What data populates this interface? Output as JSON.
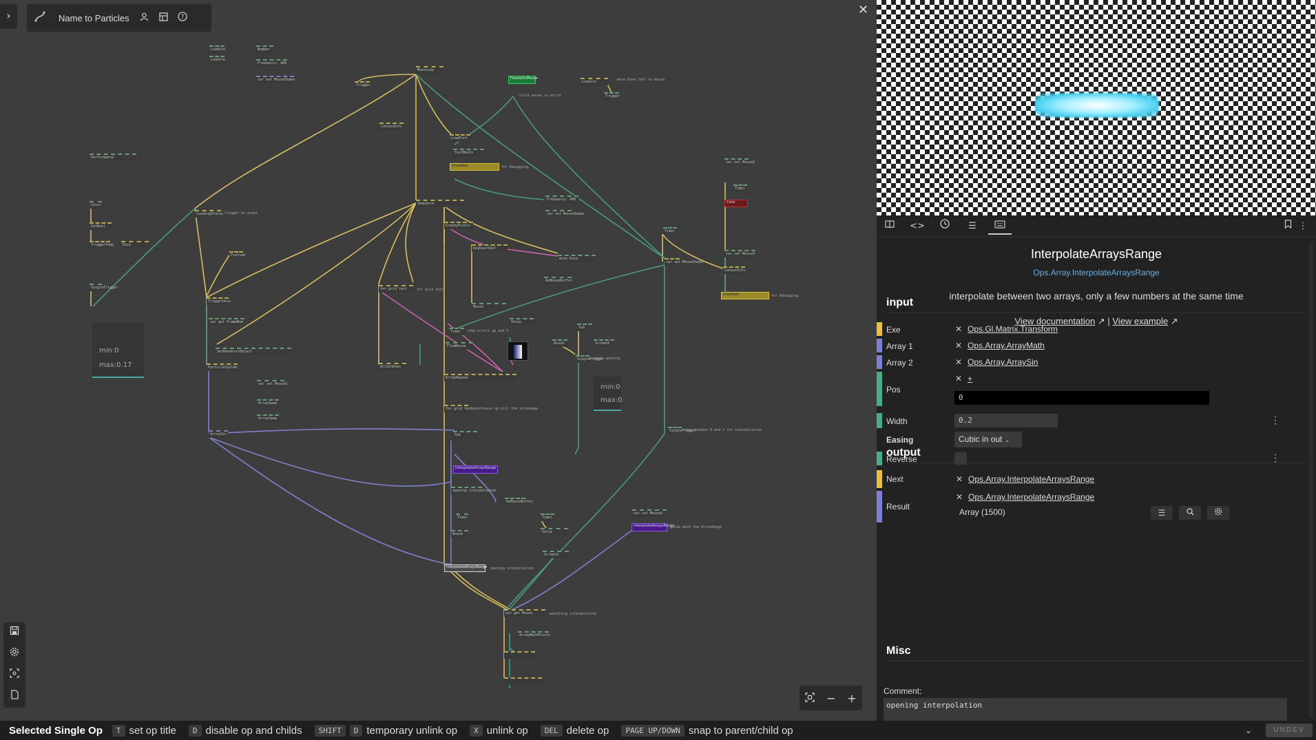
{
  "project": {
    "name": "Name to Particles"
  },
  "statusbar": {
    "selection": "Selected Single Op",
    "hints": [
      {
        "keys": [
          "T"
        ],
        "text": "set op title"
      },
      {
        "keys": [
          "D"
        ],
        "text": "disable op and childs"
      },
      {
        "keys": [
          "SHIFT",
          "D"
        ],
        "text": "temporary unlink op"
      },
      {
        "keys": [
          "X"
        ],
        "text": "unlink op"
      },
      {
        "keys": [
          "DEL"
        ],
        "text": "delete op"
      },
      {
        "keys": [
          "PAGE UP/DOWN"
        ],
        "text": "snap to parent/child op"
      }
    ]
  },
  "canvas": {
    "minmax1": {
      "min": "min:0",
      "max": "max:0.17"
    },
    "minmax2": {
      "min": "min:0",
      "max": "max:0"
    },
    "ops": [
      "Loadite",
      "Loadite",
      "Number",
      "Frequency: 480",
      "var set MouseShake",
      "MainLoop",
      "Trigger",
      "CanvasInfo",
      "FreezeOnMouse",
      "LoadFont",
      "TextMeshs",
      "DrawText",
      "for Debugging",
      "Sequence",
      "Performance",
      "Color",
      "SetBool",
      "TriggerPump",
      "Ease",
      "SingleTrigger",
      "LoadingStatus",
      "trigger on event",
      "Preload",
      "TriggerOnce",
      "var get FrameNum",
      "SetRendererObject",
      "ParticleSystem",
      "for grid test",
      "GreedyPixels",
      "KeyboardSet",
      "Mouse",
      "move Ease",
      "ActionDown",
      "Timer",
      "Value",
      "FlowMouse",
      "ArrayRepeat",
      "Sub",
      "Round",
      "ScreenX",
      "AsMouseBuffer",
      "for Debugging",
      "ArrayAddShed",
      "ArraySin",
      "var set MouseX",
      "ArraySwap",
      "InterpolateArraysRange",
      "opening interpolation",
      "InterpolateArraysRange",
      "smoothing interpolation",
      "var get Mouse",
      "TransformArray3",
      "ArrayMathPoints"
    ],
    "comments": [
      "trigger on event",
      "move Ease left to mouse",
      "click mouse in world",
      "for Debugging",
      "for debugging",
      "for grid test",
      "step scroll up and X",
      "animate opening",
      "smoothness up kill the Screengap",
      "step between 0 and 1 for interpolation",
      "guide mesh the ArrayRange",
      "opening interpolation",
      "smoothing interpolation"
    ]
  },
  "panel": {
    "tabs": [
      "book-icon",
      "code-icon",
      "clock-icon",
      "list-icon",
      "keyboard-icon"
    ],
    "op_title": "InterpolateArraysRange",
    "op_namespace": "Ops.Array.InterpolateArraysRange",
    "op_description": "interpolate between two arrays, only a few numbers at the same time",
    "view_docs": "View documentation",
    "links_separator": "|",
    "view_example": "View example",
    "input_title": "input",
    "inputs": {
      "exe": {
        "label": "Exe",
        "link": "Ops.Gl.Matrix.Transform",
        "color": "#e8c040"
      },
      "array1": {
        "label": "Array 1",
        "link": "Ops.Array.ArrayMath",
        "color": "#8080d0"
      },
      "array2": {
        "label": "Array 2",
        "link": "Ops.Array.ArraySin",
        "color": "#8080d0"
      },
      "pos": {
        "label": "Pos",
        "link": "+",
        "value": "0",
        "color": "#4aaa8a"
      },
      "width": {
        "label": "Width",
        "value": "0.2",
        "color": "#4aaa8a"
      },
      "easing": {
        "label": "Easing",
        "value": "Cubic in out"
      },
      "reverse": {
        "label": "Reverse",
        "color": "#4aaa8a"
      }
    },
    "output_title": "output",
    "outputs": {
      "next": {
        "label": "Next",
        "link": "Ops.Array.InterpolateArraysRange",
        "color": "#e8c040"
      },
      "result": {
        "label": "Result",
        "link": "Ops.Array.InterpolateArraysRange",
        "info": "Array (1500)",
        "color": "#8080d0"
      }
    },
    "misc_title": "Misc",
    "comment_label": "Comment:",
    "comment_value": "opening interpolation"
  },
  "branding": {
    "label": "UNDEV"
  }
}
